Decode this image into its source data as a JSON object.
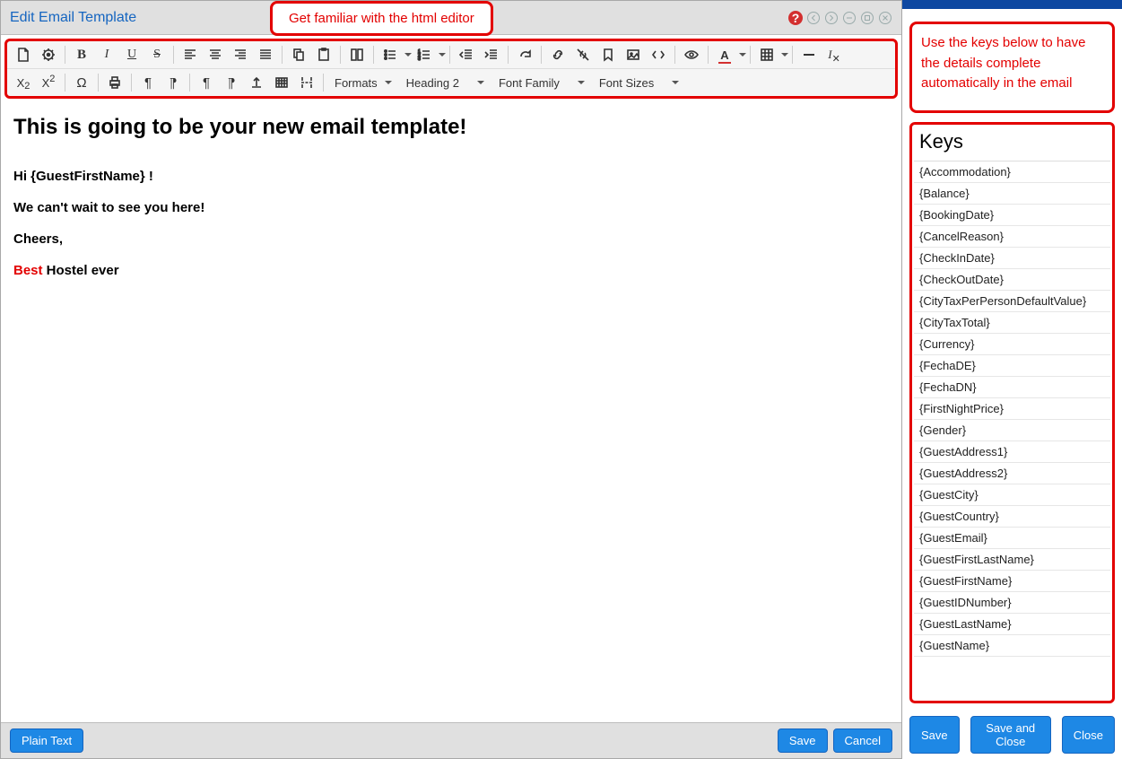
{
  "header": {
    "title": "Edit Email Template",
    "callout": "Get familiar with the html editor"
  },
  "editor_content": {
    "heading": "This is going to be your new email template!",
    "line_hi": "Hi {GuestFirstName} !",
    "line_cantwait": "We can't wait to see you here!",
    "line_cheers": "Cheers,",
    "best": "Best",
    "hostel_rest": " Hostel ever"
  },
  "toolbar": {
    "formats": "Formats",
    "heading": "Heading 2",
    "font_family": "Font Family",
    "font_sizes": "Font Sizes"
  },
  "footer": {
    "plain": "Plain Text",
    "save": "Save",
    "cancel": "Cancel"
  },
  "right": {
    "callout": "Use the keys below to have the details complete automatically in the email",
    "keys_title": "Keys",
    "keys": [
      "{Accommodation}",
      "{Balance}",
      "{BookingDate}",
      "{CancelReason}",
      "{CheckInDate}",
      "{CheckOutDate}",
      "{CityTaxPerPersonDefaultValue}",
      "{CityTaxTotal}",
      "{Currency}",
      "{FechaDE}",
      "{FechaDN}",
      "{FirstNightPrice}",
      "{Gender}",
      "{GuestAddress1}",
      "{GuestAddress2}",
      "{GuestCity}",
      "{GuestCountry}",
      "{GuestEmail}",
      "{GuestFirstLastName}",
      "{GuestFirstName}",
      "{GuestIDNumber}",
      "{GuestLastName}",
      "{GuestName}"
    ],
    "footer": {
      "save": "Save",
      "save_close": "Save and Close",
      "close": "Close"
    }
  }
}
